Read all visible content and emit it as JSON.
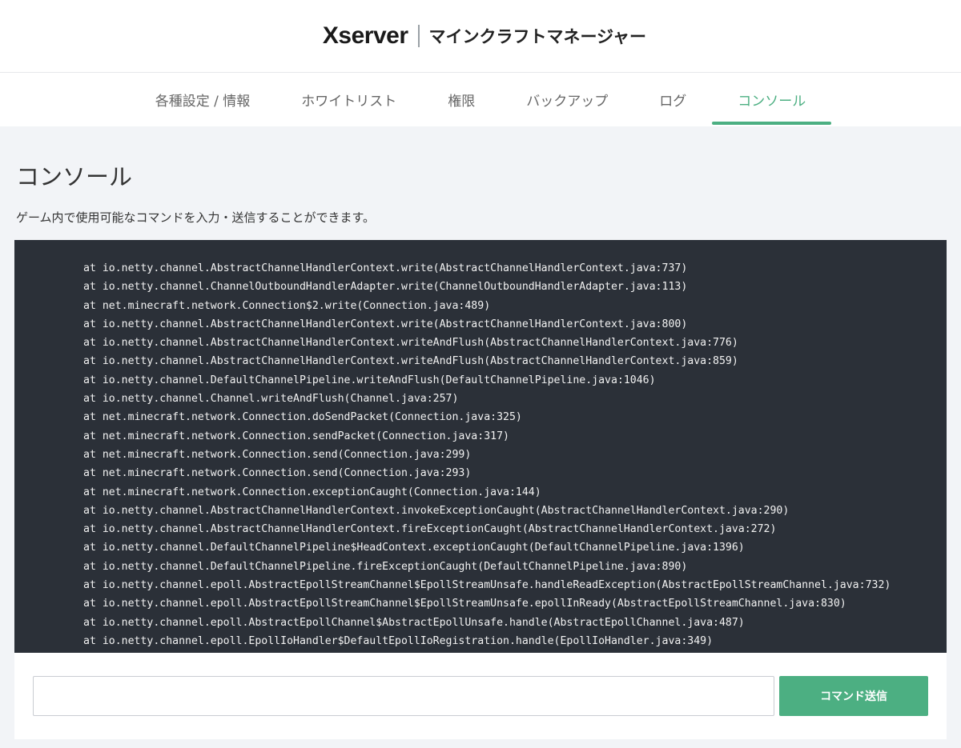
{
  "header": {
    "logo_text": "Xserver",
    "product_name": "マインクラフトマネージャー"
  },
  "tabs": [
    {
      "label": "各種設定 / 情報",
      "active": false
    },
    {
      "label": "ホワイトリスト",
      "active": false
    },
    {
      "label": "権限",
      "active": false
    },
    {
      "label": "バックアップ",
      "active": false
    },
    {
      "label": "ログ",
      "active": false
    },
    {
      "label": "コンソール",
      "active": true
    }
  ],
  "page": {
    "title": "コンソール",
    "description": "ゲーム内で使用可能なコマンドを入力・送信することができます。"
  },
  "console": {
    "lines": [
      "at io.netty.channel.AbstractChannelHandlerContext.write(AbstractChannelHandlerContext.java:737)",
      "at io.netty.channel.ChannelOutboundHandlerAdapter.write(ChannelOutboundHandlerAdapter.java:113)",
      "at net.minecraft.network.Connection$2.write(Connection.java:489)",
      "at io.netty.channel.AbstractChannelHandlerContext.write(AbstractChannelHandlerContext.java:800)",
      "at io.netty.channel.AbstractChannelHandlerContext.writeAndFlush(AbstractChannelHandlerContext.java:776)",
      "at io.netty.channel.AbstractChannelHandlerContext.writeAndFlush(AbstractChannelHandlerContext.java:859)",
      "at io.netty.channel.DefaultChannelPipeline.writeAndFlush(DefaultChannelPipeline.java:1046)",
      "at io.netty.channel.Channel.writeAndFlush(Channel.java:257)",
      "at net.minecraft.network.Connection.doSendPacket(Connection.java:325)",
      "at net.minecraft.network.Connection.sendPacket(Connection.java:317)",
      "at net.minecraft.network.Connection.send(Connection.java:299)",
      "at net.minecraft.network.Connection.send(Connection.java:293)",
      "at net.minecraft.network.Connection.exceptionCaught(Connection.java:144)",
      "at io.netty.channel.AbstractChannelHandlerContext.invokeExceptionCaught(AbstractChannelHandlerContext.java:290)",
      "at io.netty.channel.AbstractChannelHandlerContext.fireExceptionCaught(AbstractChannelHandlerContext.java:272)",
      "at io.netty.channel.DefaultChannelPipeline$HeadContext.exceptionCaught(DefaultChannelPipeline.java:1396)",
      "at io.netty.channel.DefaultChannelPipeline.fireExceptionCaught(DefaultChannelPipeline.java:890)",
      "at io.netty.channel.epoll.AbstractEpollStreamChannel$EpollStreamUnsafe.handleReadException(AbstractEpollStreamChannel.java:732)",
      "at io.netty.channel.epoll.AbstractEpollStreamChannel$EpollStreamUnsafe.epollInReady(AbstractEpollStreamChannel.java:830)",
      "at io.netty.channel.epoll.AbstractEpollChannel$AbstractEpollUnsafe.handle(AbstractEpollChannel.java:487)",
      "at io.netty.channel.epoll.EpollIoHandler$DefaultEpollIoRegistration.handle(EpollIoHandler.java:349)"
    ]
  },
  "command": {
    "input_value": "",
    "input_placeholder": "",
    "send_label": "コマンド送信"
  },
  "colors": {
    "accent": "#4caf82",
    "console_bg": "#2b3038",
    "page_bg": "#f2f4f7"
  }
}
